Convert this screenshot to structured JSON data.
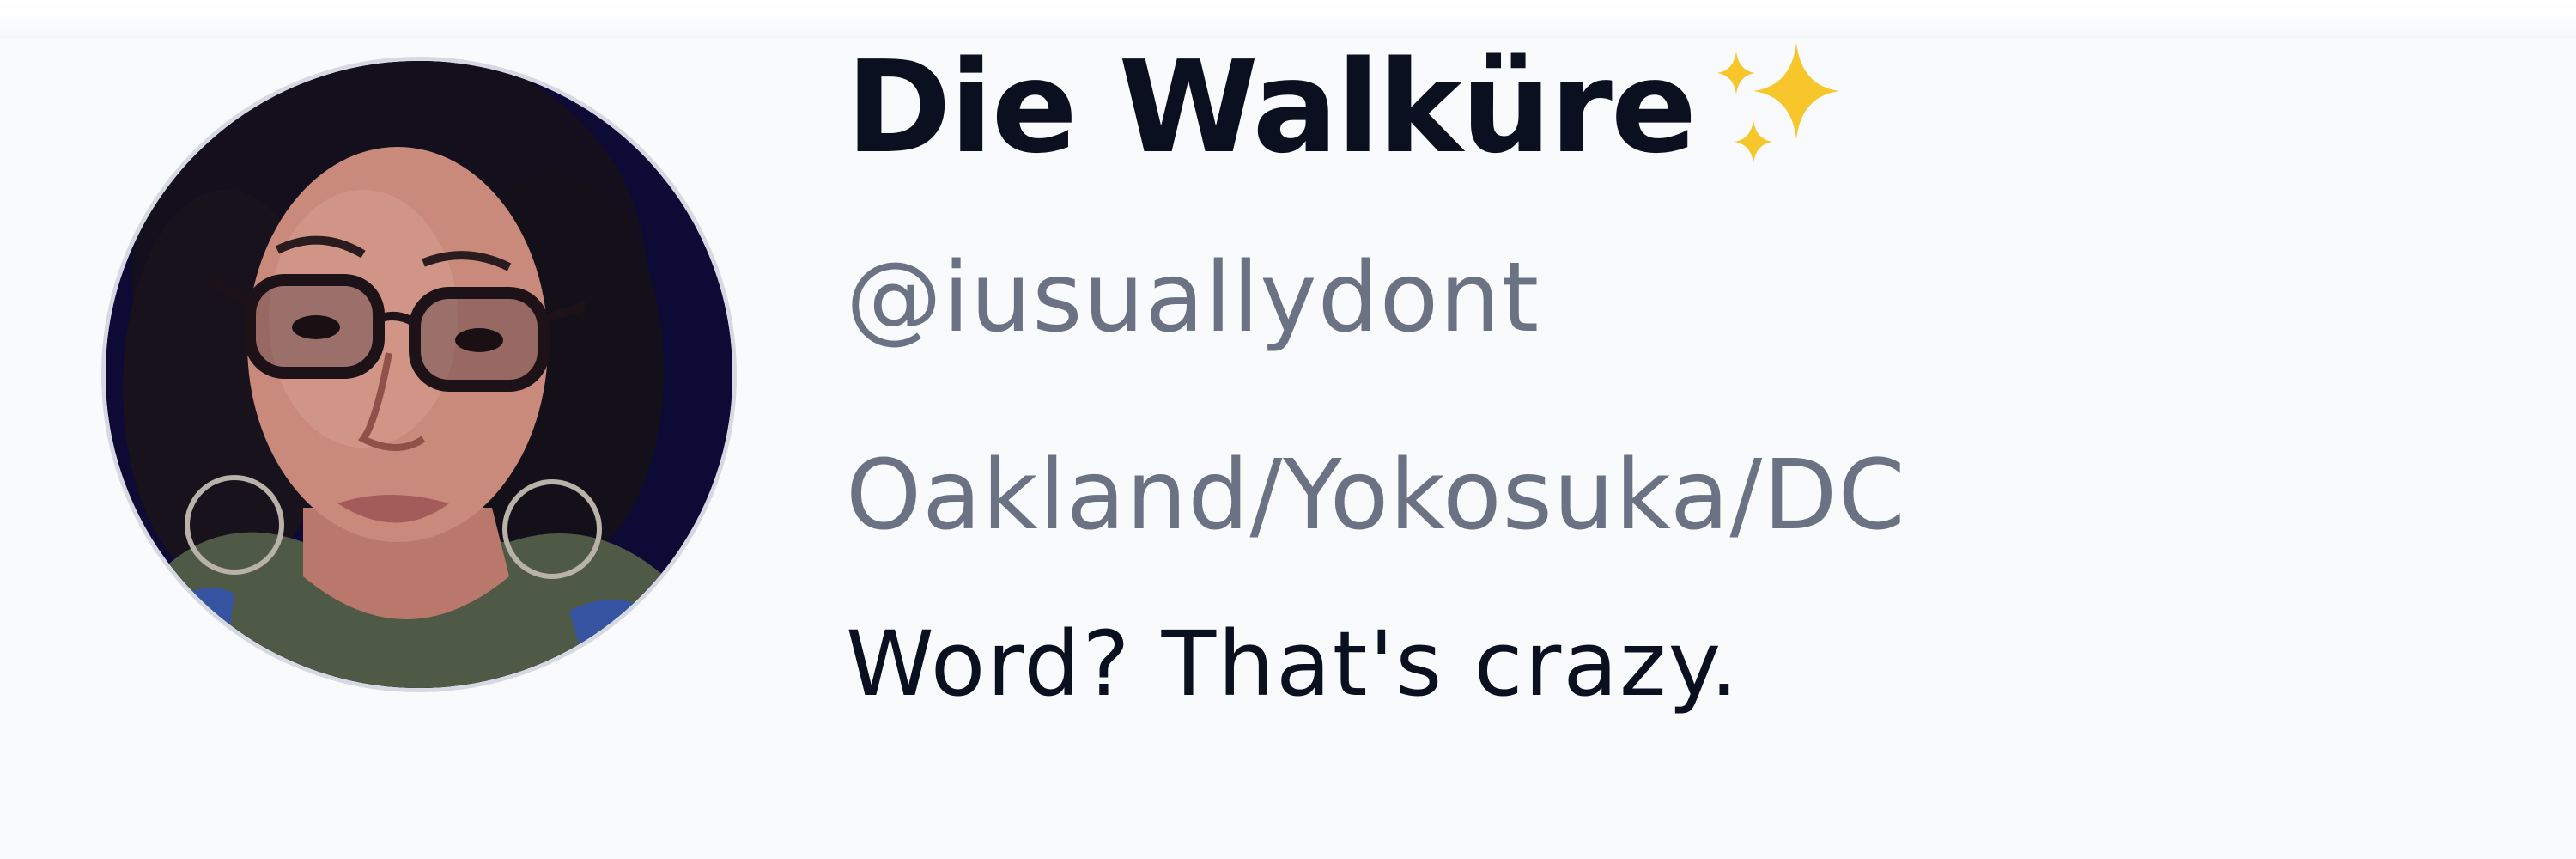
{
  "profile": {
    "display_name": "Die Walküre",
    "name_emoji": "sparkles-icon",
    "handle": "@iusuallydont",
    "location": "Oakland/Yokosuka/DC",
    "bio": "Word? That's crazy."
  },
  "colors": {
    "name": "#0b1020",
    "secondary_text": "#6b7284",
    "bio": "#0b1020",
    "background": "#f9fafc",
    "avatar_border": "#d6d9e2",
    "sparkle": "#f7c62a"
  }
}
